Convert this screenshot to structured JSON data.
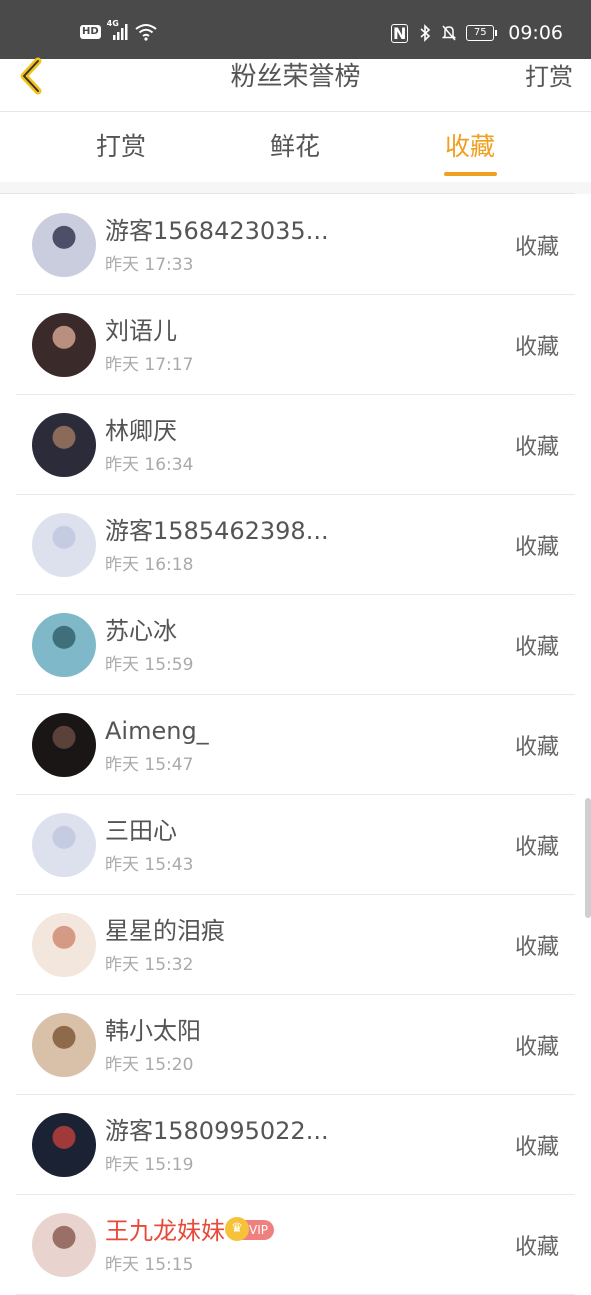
{
  "statusbar": {
    "hd": "HD",
    "net": "4G",
    "battery": "75",
    "clock": "09:06"
  },
  "navbar": {
    "title": "粉丝荣誉榜",
    "action": "打赏"
  },
  "tabs": [
    {
      "label": "打赏"
    },
    {
      "label": "鲜花"
    },
    {
      "label": "收藏"
    }
  ],
  "list": [
    {
      "name": "游客1568423035...",
      "time": "昨天 17:33",
      "action": "收藏",
      "avatar": [
        "#c9cdde",
        "#4b4f68"
      ]
    },
    {
      "name": "刘语儿",
      "time": "昨天 17:17",
      "action": "收藏",
      "avatar": [
        "#3a2a2a",
        "#b98f80"
      ]
    },
    {
      "name": "林卿厌",
      "time": "昨天 16:34",
      "action": "收藏",
      "avatar": [
        "#2c2b3a",
        "#8a6a58"
      ]
    },
    {
      "name": "游客1585462398...",
      "time": "昨天 16:18",
      "action": "收藏",
      "avatar": [
        "#dde1ee",
        "#c5cbe0"
      ]
    },
    {
      "name": "苏心冰",
      "time": "昨天 15:59",
      "action": "收藏",
      "avatar": [
        "#7fb8c9",
        "#3f6f7a"
      ]
    },
    {
      "name": "Aimeng_",
      "time": "昨天 15:47",
      "action": "收藏",
      "avatar": [
        "#1a1616",
        "#5a4238"
      ]
    },
    {
      "name": "三田心",
      "time": "昨天 15:43",
      "action": "收藏",
      "avatar": [
        "#dde1ee",
        "#c5cbe0"
      ]
    },
    {
      "name": "星星的泪痕",
      "time": "昨天 15:32",
      "action": "收藏",
      "avatar": [
        "#f3e6dc",
        "#d59a86"
      ]
    },
    {
      "name": "韩小太阳",
      "time": "昨天 15:20",
      "action": "收藏",
      "avatar": [
        "#d8c1a8",
        "#8f6a4a"
      ]
    },
    {
      "name": "游客1580995022...",
      "time": "昨天 15:19",
      "action": "收藏",
      "avatar": [
        "#1b2233",
        "#a03a3a"
      ]
    },
    {
      "name": "王九龙妹妹",
      "time": "昨天 15:15",
      "action": "收藏",
      "avatar": [
        "#e9d3cf",
        "#9a6f66"
      ],
      "vip": "VIP"
    }
  ]
}
